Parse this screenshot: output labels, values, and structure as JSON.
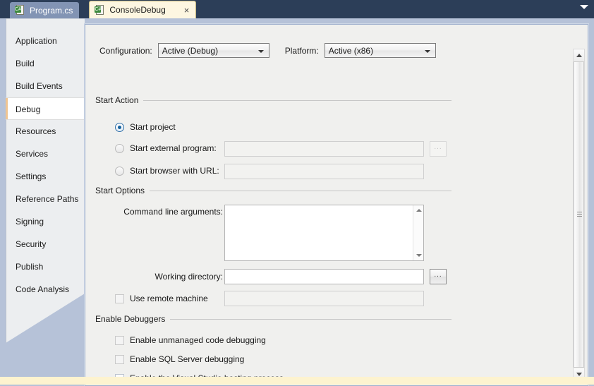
{
  "tabs": [
    {
      "label": "Program.cs",
      "icon": "csharp-file-icon",
      "active": false,
      "closable": false
    },
    {
      "label": "ConsoleDebug",
      "icon": "csharp-project-icon",
      "active": true,
      "closable": true
    }
  ],
  "tab_overflow_icon": "chevron-down-icon",
  "close_glyph": "×",
  "sidebar": {
    "items": [
      {
        "label": "Application",
        "selected": false
      },
      {
        "label": "Build",
        "selected": false
      },
      {
        "label": "Build Events",
        "selected": false
      },
      {
        "label": "Debug",
        "selected": true
      },
      {
        "label": "Resources",
        "selected": false
      },
      {
        "label": "Services",
        "selected": false
      },
      {
        "label": "Settings",
        "selected": false
      },
      {
        "label": "Reference Paths",
        "selected": false
      },
      {
        "label": "Signing",
        "selected": false
      },
      {
        "label": "Security",
        "selected": false
      },
      {
        "label": "Publish",
        "selected": false
      },
      {
        "label": "Code Analysis",
        "selected": false
      }
    ]
  },
  "header": {
    "configuration_label": "Configuration:",
    "configuration_value": "Active (Debug)",
    "platform_label": "Platform:",
    "platform_value": "Active (x86)"
  },
  "start_action": {
    "title": "Start Action",
    "options": [
      {
        "label": "Start project",
        "selected": true
      },
      {
        "label": "Start external program:",
        "selected": false,
        "value": ""
      },
      {
        "label": "Start browser with URL:",
        "selected": false,
        "value": ""
      }
    ],
    "browse_label": "..."
  },
  "start_options": {
    "title": "Start Options",
    "command_line_label": "Command line arguments:",
    "command_line_value": "",
    "working_directory_label": "Working directory:",
    "working_directory_value": "",
    "use_remote_machine_label": "Use remote machine",
    "use_remote_machine_checked": false,
    "remote_machine_value": "",
    "browse_label": "..."
  },
  "enable_debuggers": {
    "title": "Enable Debuggers",
    "items": [
      {
        "label": "Enable unmanaged code debugging",
        "checked": false
      },
      {
        "label": "Enable SQL Server debugging",
        "checked": false
      },
      {
        "label": "Enable the Visual Studio hosting process",
        "checked": true
      }
    ]
  },
  "colors": {
    "tabbar": "#2c3e58",
    "active_tab": "#fdf6e1",
    "inactive_tab": "#8294b4",
    "surface": "#b6c2d8",
    "pane": "#f0f0ee",
    "selection_accent": "#f0c592",
    "radio_accent": "#15619d"
  }
}
